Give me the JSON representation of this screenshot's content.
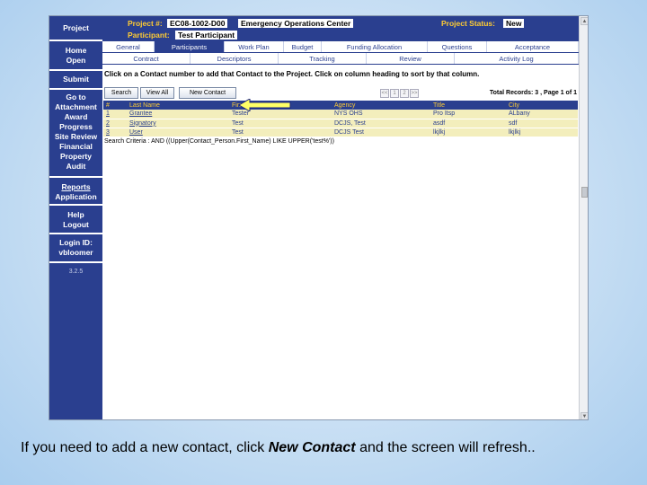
{
  "nav": {
    "project": "Project",
    "home": "Home",
    "open": "Open",
    "submit": "Submit",
    "goto": "Go to",
    "attachment": "Attachment",
    "award": "Award",
    "progress": "Progress",
    "site_review": "Site Review",
    "financial": "Financial",
    "property": "Property",
    "audit": "Audit",
    "reports": "Reports",
    "application": "Application",
    "help": "Help",
    "logout": "Logout",
    "login_label": "Login ID:",
    "login_id": "vbloomer",
    "version": "3.2.5"
  },
  "header": {
    "project_label": "Project #:",
    "project_number": "EC08-1002-D00",
    "project_name": "Emergency Operations Center",
    "status_label": "Project Status:",
    "status_value": "New",
    "participant_label": "Participant:",
    "participant_value": "Test Participant"
  },
  "tabs_row1": [
    "General",
    "Participants",
    "Work Plan",
    "Budget",
    "Funding Allocation",
    "Questions",
    "Acceptance"
  ],
  "tabs_row2": [
    "Contract",
    "Descriptors",
    "Tracking",
    "Review",
    "Activity Log"
  ],
  "instruction": "Click on a Contact number to add that Contact to the Project. Click on column heading to sort by that column.",
  "toolbar": {
    "search": "Search",
    "view_all": "View All",
    "new_contact": "New Contact",
    "pager": [
      "<<",
      "1",
      "2",
      ">>"
    ],
    "records": "Total Records: 3 , Page 1 of 1"
  },
  "table": {
    "headers": [
      "#",
      "Last Name",
      "First Name",
      "Agency",
      "Title",
      "City"
    ],
    "rows": [
      [
        "1",
        "Grantee",
        "Tester",
        "NYS OHS",
        "Pro Itsp",
        "ALbany"
      ],
      [
        "2",
        "Signatory",
        "Test",
        "DCJS, Test",
        "asdf",
        "sdf"
      ],
      [
        "3",
        "User",
        "Test",
        "DCJS Test",
        "lkjlkj",
        "lkjlkj"
      ]
    ]
  },
  "criteria": "Search Criteria : AND ((Upper(Contact_Person.First_Name) LIKE UPPER('test%'))",
  "caption": {
    "before": "If you need to add a new contact, click ",
    "emph": "New Contact",
    "after": " and the screen will refresh.."
  },
  "colors": {
    "nav_blue": "#2a3f8f",
    "accent_yellow": "#ffcc33",
    "row_yellow": "#f3eebc"
  }
}
